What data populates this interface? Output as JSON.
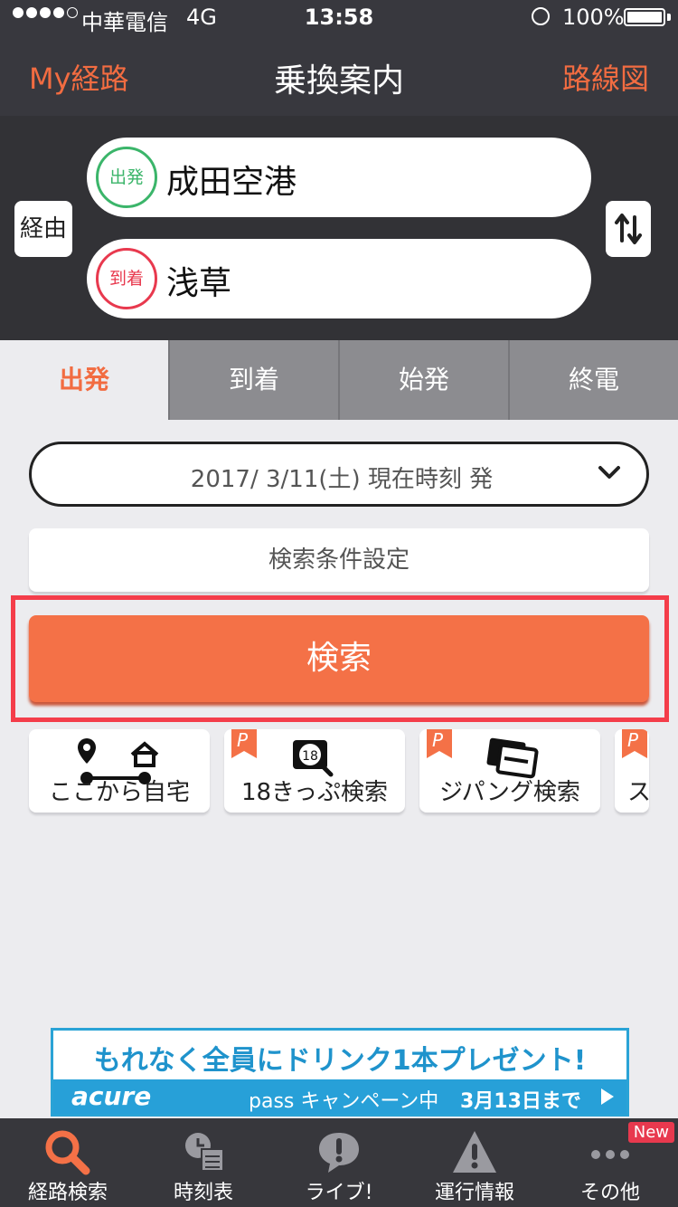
{
  "status_bar": {
    "carrier": "中華電信",
    "network": "4G",
    "time": "13:58",
    "battery": "100%"
  },
  "nav": {
    "left": "My経路",
    "title": "乗換案内",
    "right": "路線図"
  },
  "stations": {
    "via_label": "経由",
    "departure_badge": "出発",
    "departure": "成田空港",
    "arrival_badge": "到着",
    "arrival": "浅草"
  },
  "tabs": [
    {
      "label": "出発",
      "active": true
    },
    {
      "label": "到着",
      "active": false
    },
    {
      "label": "始発",
      "active": false
    },
    {
      "label": "終電",
      "active": false
    }
  ],
  "date_select": "2017/ 3/11(土) 現在時刻 発",
  "conditions_label": "検索条件設定",
  "search_label": "検索",
  "shortcuts": [
    {
      "label": "ここから自宅",
      "icon": "route-home-icon",
      "premium": false
    },
    {
      "label": "18きっぷ検索",
      "icon": "18-ticket-search-icon",
      "premium": true
    },
    {
      "label": "ジパング検索",
      "icon": "zipangu-ticket-icon",
      "premium": true
    },
    {
      "label": "ス",
      "icon": "more-shortcut-icon",
      "premium": true
    }
  ],
  "premium_mark": "P",
  "ad": {
    "line1": "もれなく全員にドリンク1本プレゼント!",
    "brand": "acure",
    "campaign": "pass キャンペーン中",
    "date": "3月13日まで"
  },
  "tab_bar": [
    {
      "label": "経路検索",
      "icon": "search-icon",
      "active": true
    },
    {
      "label": "時刻表",
      "icon": "timetable-icon",
      "active": false
    },
    {
      "label": "ライブ!",
      "icon": "live-icon",
      "active": false
    },
    {
      "label": "運行情報",
      "icon": "warning-icon",
      "active": false
    },
    {
      "label": "その他",
      "icon": "more-icon",
      "active": false,
      "badge": "New"
    }
  ],
  "colors": {
    "accent": "#f26c41",
    "header_bg": "#38383e",
    "departure": "#3bb56a",
    "arrival": "#e8394e"
  }
}
